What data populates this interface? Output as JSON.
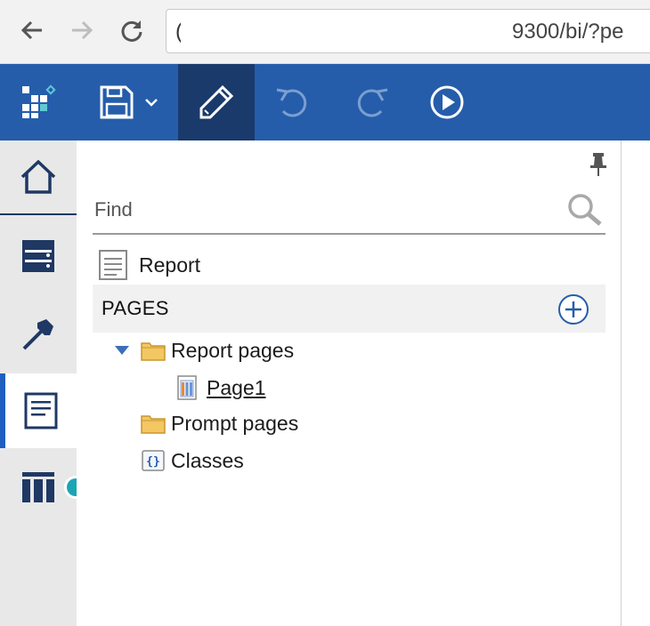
{
  "browser": {
    "back_icon": "back-arrow-icon",
    "forward_icon": "forward-arrow-icon",
    "reload_icon": "reload-icon",
    "address_lead": "(",
    "address_url": "9300/bi/?pe"
  },
  "toolbar": {
    "app_icon": "app-logo-icon",
    "save_icon": "save-icon",
    "edit_icon": "pencil-icon",
    "undo_icon": "undo-icon",
    "redo_icon": "redo-icon",
    "run_icon": "run-icon",
    "bg_color": "#255dab",
    "active_color": "#1a3a6c"
  },
  "rail": {
    "items": [
      "home-icon",
      "data-icon",
      "toolbox-icon",
      "pages-icon",
      "data-items-icon"
    ],
    "status_color": "#1aa5b5"
  },
  "panel": {
    "search_placeholder": "Find",
    "report_label": "Report",
    "pages_header": "PAGES",
    "tree": {
      "report_pages": "Report pages",
      "page1": "Page1",
      "prompt_pages": "Prompt pages",
      "classes": "Classes"
    }
  }
}
